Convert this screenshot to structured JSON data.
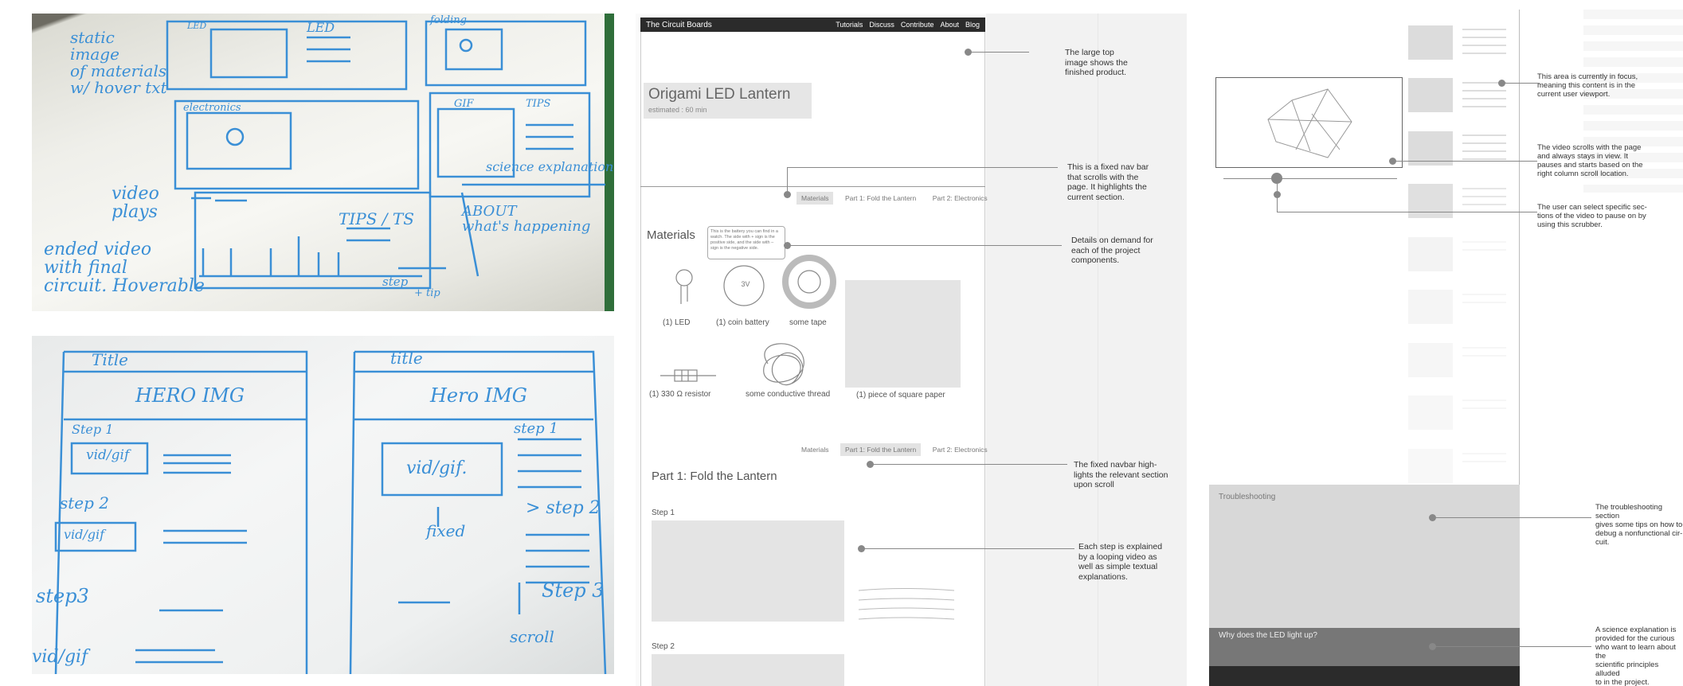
{
  "sketches": {
    "top": {
      "labels": [
        "static\nimage\nof materials\nw/ hover txt",
        "LED",
        "LED",
        "folding",
        "electronics",
        "GIF",
        "TIPS",
        "video\nplays",
        "science explanation",
        "TIPS / TS",
        "ABOUT\nwhat's happening",
        "ended video\nwith final\ncircuit. Hoverable",
        "step",
        "+ tip"
      ]
    },
    "bottom": {
      "left_title": "Title",
      "right_title": "title",
      "left_hero": "HERO IMG",
      "right_hero": "Hero IMG",
      "step1_left": "Step 1",
      "step1_right": "step 1",
      "vid_left": "vid/gif",
      "vid_right": "vid/gif.",
      "fixed": "fixed",
      "step2_left": "step 2",
      "step2_right": "> step 2",
      "vid2_left": "vid/gif",
      "step3_left": "step3",
      "step3_right": "Step 3",
      "scroll": "scroll",
      "vid3_left": "vid/gif"
    }
  },
  "wire1": {
    "site_title": "The Circuit Boards",
    "nav": [
      "Tutorials",
      "Discuss",
      "Contribute",
      "About",
      "Blog"
    ],
    "hero_title": "Origami LED Lantern",
    "hero_subtitle": "estimated : 60 min",
    "subnav1": [
      "Materials",
      "Part 1: Fold the Lantern",
      "Part 2: Electronics"
    ],
    "materials_heading": "Materials",
    "tooltip": "This is the battery you can find in a watch. The side with + sign is the positive side, and the side with – sign is the negative side.",
    "battery_label": "3V",
    "items": {
      "led": "(1) LED",
      "battery": "(1) coin battery",
      "tape": "some tape",
      "resistor": "(1) 330 Ω resistor",
      "thread": "some conductive thread",
      "paper": "(1) piece of square paper"
    },
    "subnav2": [
      "Materials",
      "Part 1: Fold the Lantern",
      "Part 2: Electronics"
    ],
    "part1_heading": "Part 1: Fold the Lantern",
    "step1": "Step 1",
    "step2": "Step 2",
    "annotations": {
      "hero": "The large top\nimage shows the\nfinished product.",
      "navbar": "This is a fixed nav bar\nthat scrolls with the\npage. It highlights the\ncurrent section.",
      "details": "Details on demand for\neach of the project\ncomponents.",
      "highlight": "The fixed navbar high-\nlights the relevant section\nupon scroll",
      "steps": "Each step is explained\nby a looping video as\nwell as simple textual\nexplanations."
    }
  },
  "wire2": {
    "troubleshooting": "Troubleshooting",
    "science": "Why does the LED light up?",
    "annotations": {
      "focus": "This area is currently in focus,\nmeaning this content is in the\ncurrent user viewport.",
      "video": "The video scrolls with the page\nand always stays in view. It\npauses and starts based on the\nright column scroll location.",
      "scrubber": "The user can select specific sec-\ntions of the video to pause on by\nusing this scrubber.",
      "trouble": "The troubleshooting section\ngives some tips on how to\ndebug a nonfunctional cir-\ncuit.",
      "science_note": "A science explanation is\nprovided for the curious\nwho want to learn about the\nscientific principles alluded\nto in the project."
    }
  }
}
